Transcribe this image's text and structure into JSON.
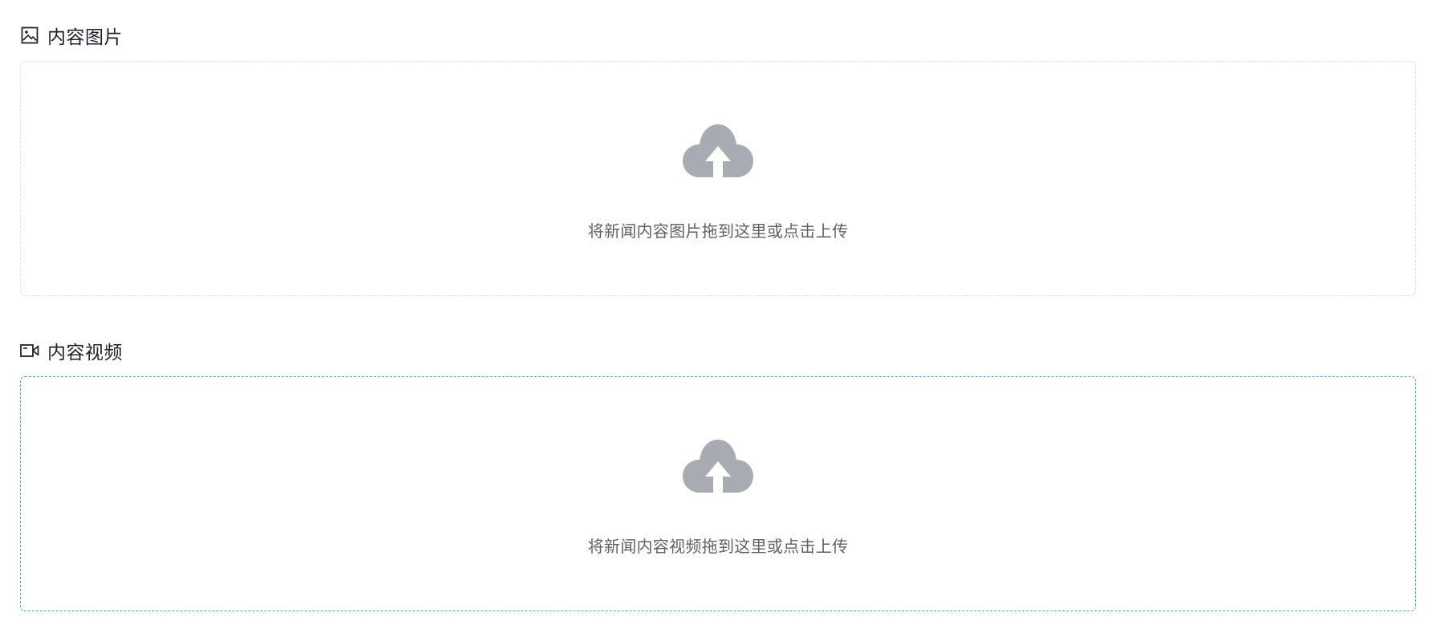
{
  "images_section": {
    "title": "内容图片",
    "icon": "image-icon",
    "dropzone_text": "将新闻内容图片拖到这里或点击上传",
    "upload_icon": "cloud-upload-icon"
  },
  "videos_section": {
    "title": "内容视频",
    "icon": "video-camera-icon",
    "dropzone_text": "将新闻内容视频拖到这里或点击上传",
    "upload_icon": "cloud-upload-icon"
  },
  "colors": {
    "dropzone_border": "#dcdfe6",
    "dropzone_border_active": "#409eff",
    "upload_icon_fill": "#a8abb2",
    "hint_text": "#606266",
    "title_text": "#1f2329"
  }
}
